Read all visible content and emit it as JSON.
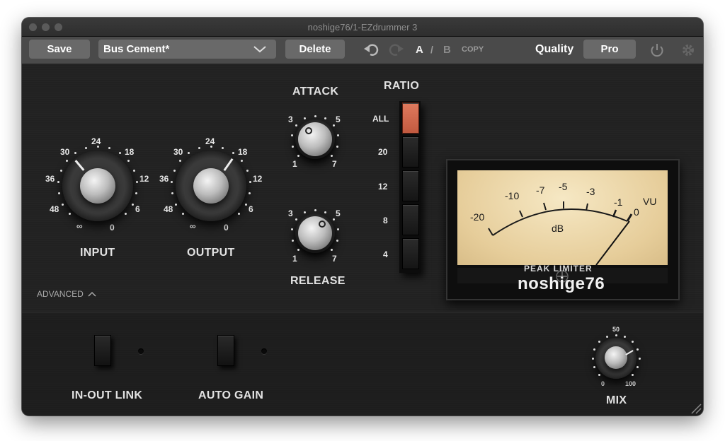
{
  "window": {
    "title": "noshige76/1-EZdrummer 3"
  },
  "toolbar": {
    "save_label": "Save",
    "preset_name": "Bus Cement*",
    "delete_label": "Delete",
    "a_label": "A",
    "slash": "/",
    "b_label": "B",
    "copy_label": "COPY",
    "quality_label": "Quality",
    "quality_value": "Pro"
  },
  "controls": {
    "input": {
      "label": "INPUT",
      "ticks": [
        "24",
        "30",
        "18",
        "36",
        "12",
        "48",
        "6",
        "∞",
        "0"
      ],
      "value": 30
    },
    "output": {
      "label": "OUTPUT",
      "ticks": [
        "24",
        "30",
        "18",
        "36",
        "12",
        "48",
        "6",
        "∞",
        "0"
      ],
      "value": 18
    },
    "attack": {
      "label": "ATTACK",
      "ticks": [
        "3",
        "5",
        "1",
        "7"
      ],
      "value": 3
    },
    "release": {
      "label": "RELEASE",
      "ticks": [
        "3",
        "5",
        "1",
        "7"
      ],
      "value": 5
    },
    "ratio": {
      "label": "RATIO",
      "options": [
        "ALL",
        "20",
        "12",
        "8",
        "4"
      ],
      "selected": "ALL"
    }
  },
  "meter": {
    "scale": [
      "-20",
      "-10",
      "-7",
      "-5",
      "-3",
      "-1",
      "0"
    ],
    "unit": "dB",
    "vu": "VU"
  },
  "branding": {
    "subtitle": "PEAK LIMITER",
    "name": "noshige76"
  },
  "advanced": {
    "label": "ADVANCED"
  },
  "lower": {
    "in_out_link": "IN-OUT LINK",
    "auto_gain": "AUTO GAIN",
    "mix": {
      "label": "MIX",
      "min": "0",
      "mid": "50",
      "max": "100",
      "value": 100
    }
  },
  "colors": {
    "accent": "#d4634a",
    "panel": "#222222",
    "toolbar": "#4a4a4a"
  }
}
